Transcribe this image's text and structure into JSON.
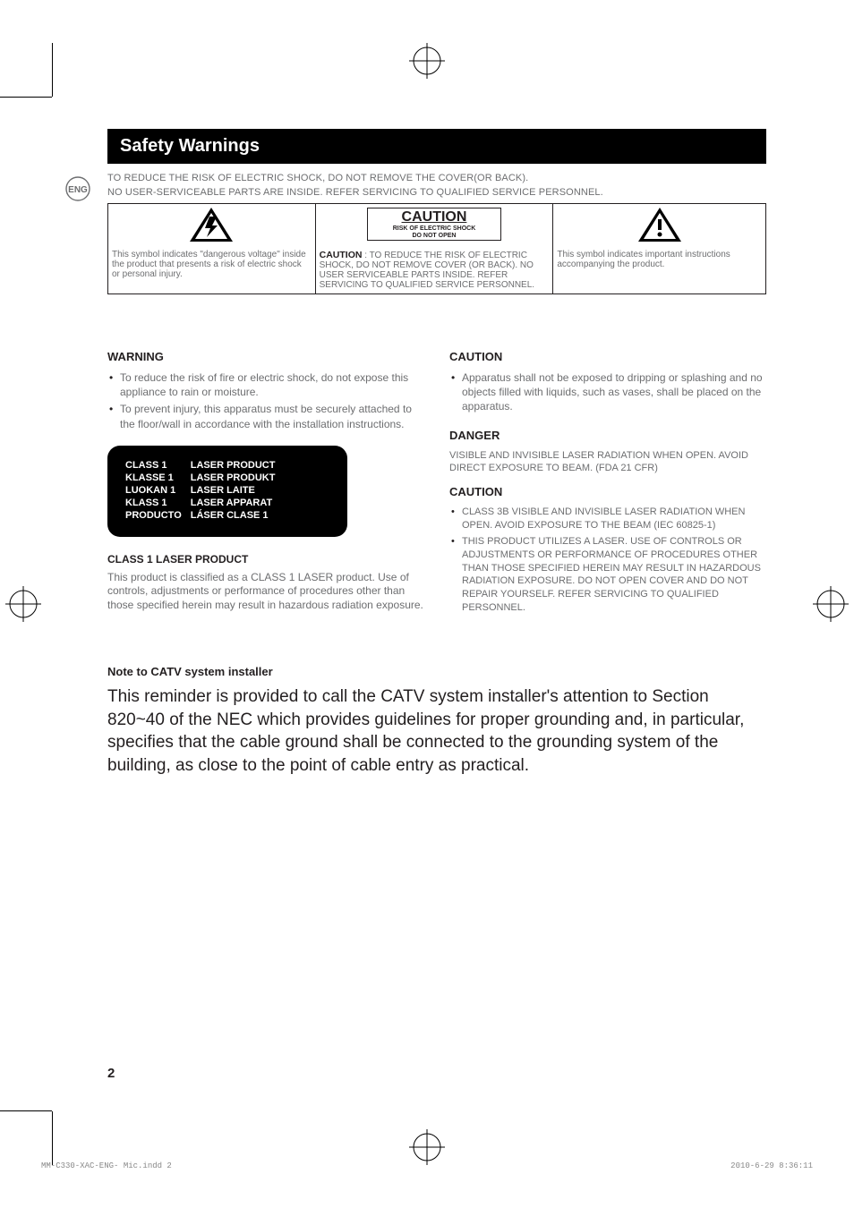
{
  "title": "Safety Warnings",
  "lang_badge": "ENG",
  "intro_line1": "TO REDUCE THE RISK OF ELECTRIC SHOCK, DO NOT REMOVE THE COVER(OR BACK).",
  "intro_line2": "NO USER-SERVICEABLE PARTS ARE INSIDE. REFER SERVICING TO QUALIFIED SERVICE PERSONNEL.",
  "caution_box": {
    "title": "CAUTION",
    "line1": "RISK OF ELECTRIC SHOCK",
    "line2": "DO NOT OPEN"
  },
  "table": {
    "left": "This symbol indicates \"dangerous voltage\" inside the product that presents a risk of electric shock or personal injury.",
    "mid_bold": "CAUTION",
    "mid_rest": " : TO REDUCE THE RISK OF ELECTRIC SHOCK, DO NOT REMOVE COVER (OR BACK). NO USER SERVICEABLE PARTS INSIDE. REFER SERVICING TO QUALIFIED SERVICE PERSONNEL.",
    "right": "This symbol indicates important instructions accompanying the product."
  },
  "left_col": {
    "warning_head": "WARNING",
    "warning_items": [
      "To reduce the risk of fire or electric shock, do not expose this appliance to rain or moisture.",
      "To prevent injury, this apparatus must be securely attached to the floor/wall in accordance with the installation instructions."
    ],
    "laser_rows": [
      [
        "CLASS 1",
        "LASER PRODUCT"
      ],
      [
        "KLASSE 1",
        "LASER PRODUKT"
      ],
      [
        "LUOKAN 1",
        "LASER LAITE"
      ],
      [
        "KLASS 1",
        "LASER APPARAT"
      ],
      [
        "PRODUCTO",
        "LÁSER CLASE 1"
      ]
    ],
    "class1_head": "CLASS 1 LASER PRODUCT",
    "class1_body": "This product is classified as a CLASS 1 LASER product. Use of controls, adjustments or performance of procedures other than those specified herein may result in hazardous radiation exposure."
  },
  "right_col": {
    "caution1_head": "CAUTION",
    "caution1_items": [
      "Apparatus shall not be exposed to dripping or splashing and no objects filled with liquids, such as vases, shall be placed on the apparatus."
    ],
    "danger_head": "DANGER",
    "danger_body": "VISIBLE AND INVISIBLE LASER RADIATION WHEN OPEN. AVOID DIRECT EXPOSURE TO BEAM. (FDA 21 CFR)",
    "caution2_head": "CAUTION",
    "caution2_items": [
      "CLASS 3B VISIBLE AND INVISIBLE LASER RADIATION WHEN OPEN. AVOID EXPOSURE TO THE BEAM (IEC 60825-1)",
      "THIS PRODUCT UTILIZES A LASER. USE OF CONTROLS OR ADJUSTMENTS OR PERFORMANCE OF PROCEDURES OTHER THAN THOSE SPECIFIED HEREIN MAY RESULT IN HAZARDOUS RADIATION EXPOSURE. DO NOT OPEN COVER AND DO NOT REPAIR YOURSELF. REFER SERVICING TO QUALIFIED PERSONNEL."
    ]
  },
  "note": {
    "head": "Note to CATV system installer",
    "body": "This reminder is provided to call the CATV system installer's attention to Section 820~40 of the NEC which provides guidelines for proper grounding and, in particular, specifies that the cable ground shall be connected to the grounding system of the building, as close to the point of cable entry as practical."
  },
  "page_num": "2",
  "footer_left": "MM-C330-XAC-ENG- Mic.indd   2",
  "footer_right": "2010-6-29   8:36:11"
}
